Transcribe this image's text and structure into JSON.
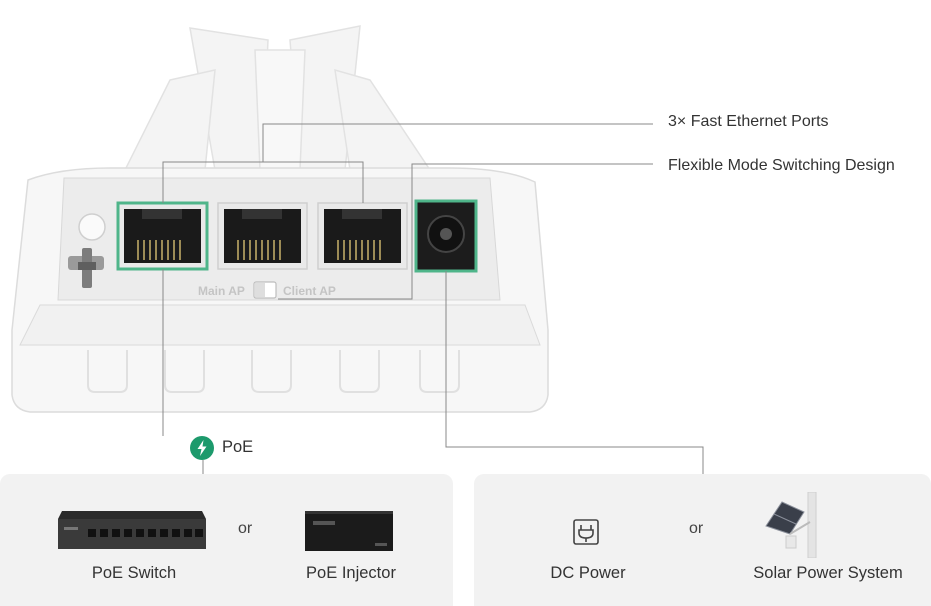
{
  "callouts": {
    "ports": "3× Fast Ethernet Ports",
    "mode": "Flexible Mode Switching Design"
  },
  "device": {
    "switch_left": "Main AP",
    "switch_right": "Client AP"
  },
  "poe": {
    "label": "PoE",
    "icon": "lightning-bolt-icon"
  },
  "left_panel": {
    "item1": "PoE Switch",
    "or": "or",
    "item2": "PoE Injector"
  },
  "right_panel": {
    "item1": "DC Power",
    "or": "or",
    "item2": "Solar Power System"
  },
  "colors": {
    "highlight": "#4fb58a",
    "poe_badge": "#1d9a6c",
    "panel_bg": "#f2f2f2"
  }
}
